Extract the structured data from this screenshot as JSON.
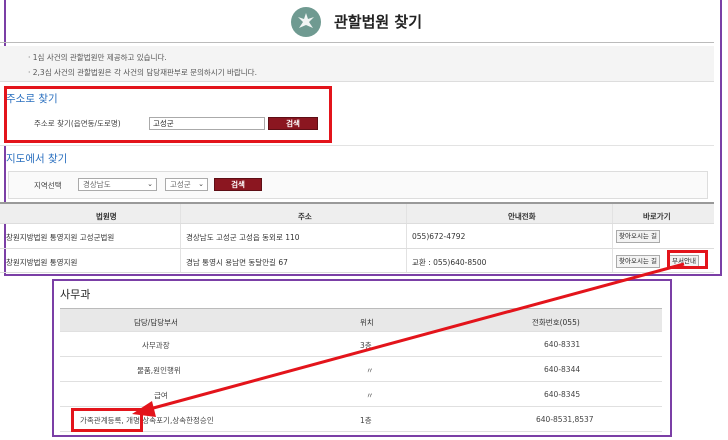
{
  "header": {
    "title": "관할법원 찾기"
  },
  "notice": {
    "lines": [
      "· 1심 사건의 관할법원만 제공하고 있습니다.",
      "· 2,3심 사건의 관할법원은 각 사건의 담당재판부로 문의하시기 바랍니다."
    ]
  },
  "address_search": {
    "heading": "주소로 찾기",
    "label": "주소로 찾기(읍면동/도로명)",
    "input_value": "고성군",
    "button": "검색"
  },
  "map_search": {
    "heading": "지도에서 찾기",
    "region_label": "지역선택",
    "province": "경상남도",
    "county": "고성군",
    "button": "검색"
  },
  "court_table": {
    "columns": [
      "법원명",
      "주소",
      "안내전화",
      "바로가기"
    ],
    "rows": [
      {
        "name": "창원지방법원 통영지원 고성군법원",
        "address": "경상남도 고성군 고성읍 동외로 110",
        "phone": "055)672-4792",
        "btn_directions": "찾아오시는 길"
      },
      {
        "name": "창원지방법원 통영지원",
        "address": "경남 통영시 용남면 동달안길 67",
        "phone": "교환 : 055)640-8500",
        "btn_directions": "찾아오시는 길",
        "btn_dept": "부서안내"
      }
    ]
  },
  "office": {
    "title": "사무과",
    "columns": [
      "담당/담당부서",
      "위치",
      "전화번호(055)"
    ],
    "rows": [
      {
        "dept": "사무과장",
        "location": "3층",
        "phone": "640-8331"
      },
      {
        "dept": "물품,원인행위",
        "location": "〃",
        "phone": "640-8344"
      },
      {
        "dept": "급여",
        "location": "〃",
        "phone": "640-8345"
      },
      {
        "dept": "가족관계등록, 개명,상속포기,상속한정승인",
        "location": "1층",
        "phone": "640-8531,8537"
      }
    ]
  },
  "colors": {
    "accent": "#2a6fbf",
    "search_button": "#8b1620",
    "highlight": "#e3141b",
    "frame": "#7b3fa6"
  },
  "icons": {
    "logo": "court-emblem-icon",
    "dropdown": "chevron-down-icon"
  }
}
